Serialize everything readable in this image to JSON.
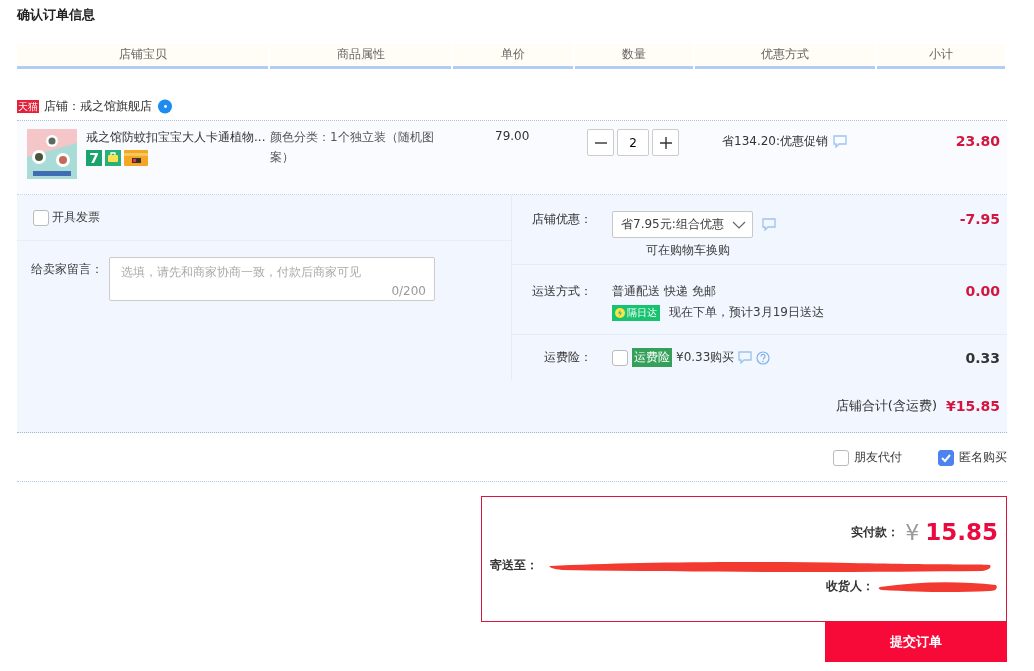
{
  "page_title": "确认订单信息",
  "columns": [
    "店铺宝贝",
    "商品属性",
    "单价",
    "数量",
    "优惠方式",
    "小计"
  ],
  "shop": {
    "badge": "天猫",
    "label": "店铺：戒之馆旗舰店"
  },
  "item": {
    "title": "戒之馆防蚊扣宝宝大人卡通植物...",
    "return_badge": "7",
    "attributes": "颜色分类：1个独立装（随机图案）",
    "price": "79.00",
    "quantity": "2",
    "promotion": "省134.20:优惠促销",
    "subtotal": "23.80"
  },
  "invoice": {
    "label": "开具发票",
    "checked": false
  },
  "message": {
    "label": "给卖家留言：",
    "placeholder": "选填，请先和商家协商一致，付款后商家可见",
    "counter": "0/200"
  },
  "store_discount": {
    "label": "店铺优惠：",
    "value": "省7.95元:组合优惠",
    "note": "可在购物车换购",
    "amount": "-7.95"
  },
  "shipping": {
    "label": "运送方式：",
    "method": "普通配送 快递 免邮",
    "badge": "隔日达",
    "estimate": "现在下单，预计3月19日送达",
    "amount": "0.00"
  },
  "insurance": {
    "label": "运费险：",
    "checked": false,
    "tag": "运费险",
    "price": "¥0.33购买",
    "amount": "0.33"
  },
  "store_total": {
    "label": "店铺合计(含运费)",
    "amount": "¥15.85"
  },
  "options": [
    {
      "label": "朋友代付",
      "checked": false
    },
    {
      "label": "匿名购买",
      "checked": true
    }
  ],
  "summary": {
    "paid_label": "实付款：",
    "currency": "¥",
    "paid": "15.85",
    "ship_to_label": "寄送至：",
    "receiver_label": "收货人："
  },
  "submit": "提交订单"
}
